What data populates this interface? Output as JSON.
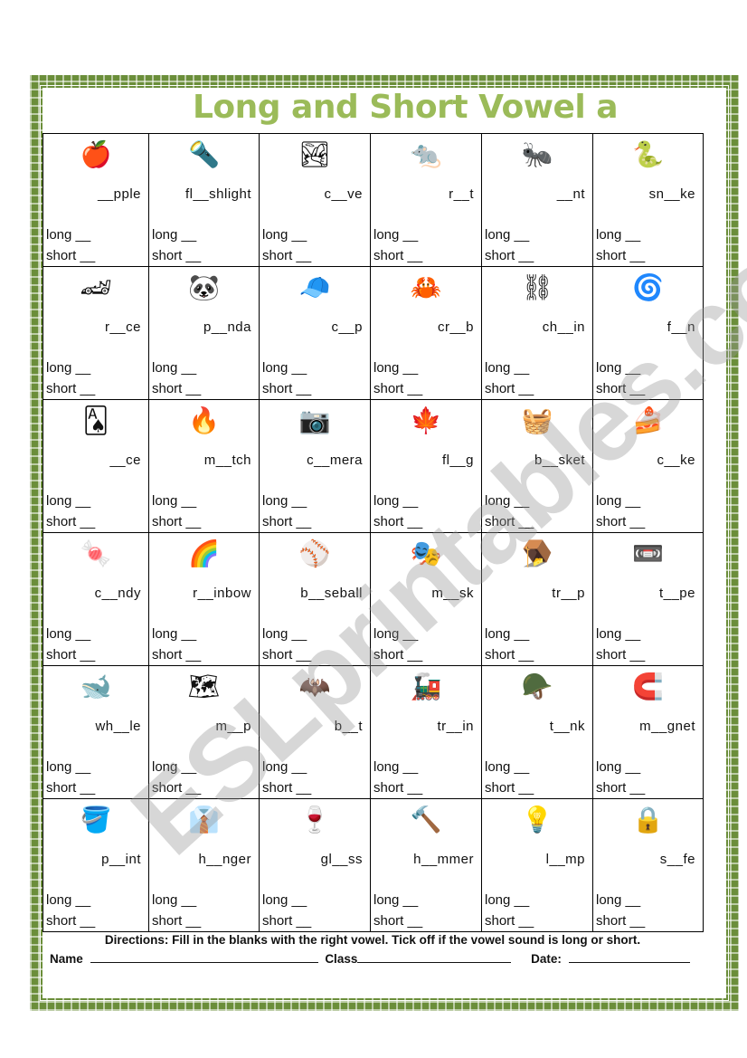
{
  "title": "Long and Short Vowel a",
  "labels": {
    "long": "long __",
    "short": "short __"
  },
  "rows": [
    [
      {
        "word": "__pple",
        "icon": "apple-icon",
        "glyph": "🍎"
      },
      {
        "word": "fl__shlight",
        "icon": "flashlight-icon",
        "glyph": "🔦"
      },
      {
        "word": "c__ve",
        "icon": "cave-icon",
        "glyph": "🏞"
      },
      {
        "word": "r__t",
        "icon": "rat-icon",
        "glyph": "🐀"
      },
      {
        "word": "__nt",
        "icon": "ant-icon",
        "glyph": "🐜"
      },
      {
        "word": "sn__ke",
        "icon": "snake-icon",
        "glyph": "🐍"
      }
    ],
    [
      {
        "word": "r__ce",
        "icon": "race-car-icon",
        "glyph": "🏎"
      },
      {
        "word": "p__nda",
        "icon": "panda-icon",
        "glyph": "🐼"
      },
      {
        "word": "c__p",
        "icon": "propeller-cap-icon",
        "glyph": "🧢"
      },
      {
        "word": "cr__b",
        "icon": "crab-icon",
        "glyph": "🦀"
      },
      {
        "word": "ch__in",
        "icon": "chain-icon",
        "glyph": "⛓"
      },
      {
        "word": "f__n",
        "icon": "ceiling-fan-icon",
        "glyph": "🌀"
      }
    ],
    [
      {
        "word": "__ce",
        "icon": "ace-card-icon",
        "glyph": "🂡"
      },
      {
        "word": "m__tch",
        "icon": "match-icon",
        "glyph": "🔥"
      },
      {
        "word": "c__mera",
        "icon": "camera-icon",
        "glyph": "📷"
      },
      {
        "word": "fl__g",
        "icon": "canada-flag-icon",
        "glyph": "🍁"
      },
      {
        "word": "b__sket",
        "icon": "basket-icon",
        "glyph": "🧺"
      },
      {
        "word": "c__ke",
        "icon": "cake-icon",
        "glyph": "🍰"
      }
    ],
    [
      {
        "word": "c__ndy",
        "icon": "candy-icon",
        "glyph": "🍬"
      },
      {
        "word": "r__inbow",
        "icon": "rainbow-icon",
        "glyph": "🌈"
      },
      {
        "word": "b__seball",
        "icon": "baseball-icon",
        "glyph": "⚾"
      },
      {
        "word": "m__sk",
        "icon": "mask-icon",
        "glyph": "🎭"
      },
      {
        "word": "tr__p",
        "icon": "trap-icon",
        "glyph": "🪤"
      },
      {
        "word": "t__pe",
        "icon": "tape-dispenser-icon",
        "glyph": "📼"
      }
    ],
    [
      {
        "word": "wh__le",
        "icon": "whale-icon",
        "glyph": "🐋"
      },
      {
        "word": "m__p",
        "icon": "map-icon",
        "glyph": "🗺"
      },
      {
        "word": "b__t",
        "icon": "bat-icon",
        "glyph": "🦇"
      },
      {
        "word": "tr__in",
        "icon": "train-icon",
        "glyph": "🚂"
      },
      {
        "word": "t__nk",
        "icon": "tank-icon",
        "glyph": "🪖"
      },
      {
        "word": "m__gnet",
        "icon": "magnet-icon",
        "glyph": "🧲"
      }
    ],
    [
      {
        "word": "p__int",
        "icon": "paint-can-icon",
        "glyph": "🪣"
      },
      {
        "word": "h__nger",
        "icon": "hanger-icon",
        "glyph": "👔"
      },
      {
        "word": "gl__ss",
        "icon": "wine-glass-icon",
        "glyph": "🍷"
      },
      {
        "word": "h__mmer",
        "icon": "hammer-icon",
        "glyph": "🔨"
      },
      {
        "word": "l__mp",
        "icon": "lamp-icon",
        "glyph": "💡"
      },
      {
        "word": "s__fe",
        "icon": "safe-icon",
        "glyph": "🔒"
      }
    ]
  ],
  "directions": "Directions: Fill in the blanks with the right vowel. Tick off if the vowel sound is long or short.",
  "footer": {
    "name_label": "Name",
    "class_label": "Class",
    "date_label": "Date:"
  },
  "watermark": "ESLprintables.com",
  "colors": {
    "title": "#9bbb59",
    "border": "#6b8e3a"
  }
}
